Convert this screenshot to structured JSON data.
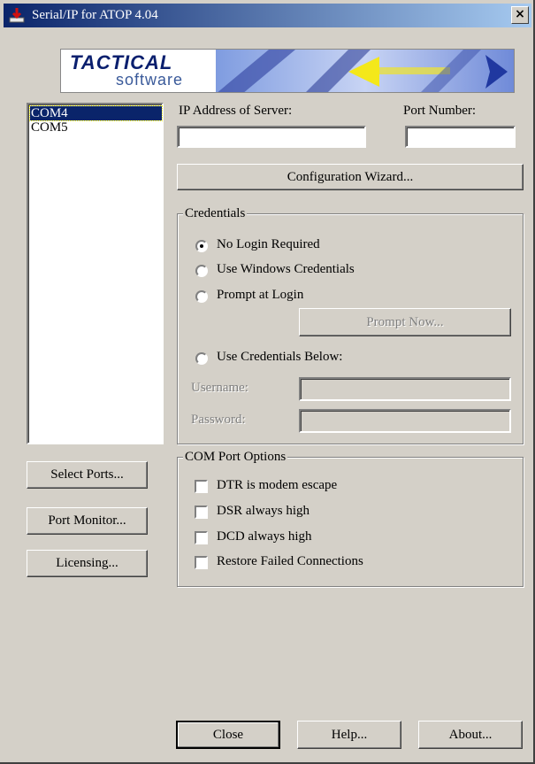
{
  "window": {
    "title": "Serial/IP for ATOP 4.04",
    "close_glyph": "×",
    "title_color_start": "#0a246a",
    "face_color": "#d4d0c8"
  },
  "banner": {
    "line1": "TACTICAL",
    "line2": "software"
  },
  "ports": {
    "items": [
      "COM4",
      "COM5"
    ],
    "selected": "COM4"
  },
  "server": {
    "ip_label": "IP Address of Server:",
    "ip_value": "",
    "port_label": "Port Number:",
    "port_value": ""
  },
  "wizard_button": "Configuration Wizard...",
  "credentials": {
    "legend": "Credentials",
    "options": [
      "No Login Required",
      "Use Windows Credentials",
      "Prompt at Login",
      "Use Credentials Below:"
    ],
    "selected": "No Login Required",
    "prompt_now": "Prompt Now...",
    "username_label": "Username:",
    "username_value": "",
    "password_label": "Password:",
    "password_value": ""
  },
  "com_options": {
    "legend": "COM Port Options",
    "options": [
      {
        "label": "DTR is modem escape",
        "checked": false
      },
      {
        "label": "DSR always high",
        "checked": false
      },
      {
        "label": "DCD always high",
        "checked": false
      },
      {
        "label": "Restore Failed Connections",
        "checked": false
      }
    ]
  },
  "left_buttons": {
    "select_ports": "Select Ports...",
    "port_monitor": "Port Monitor...",
    "licensing": "Licensing..."
  },
  "bottom_buttons": {
    "close": "Close",
    "help": "Help...",
    "about": "About..."
  }
}
